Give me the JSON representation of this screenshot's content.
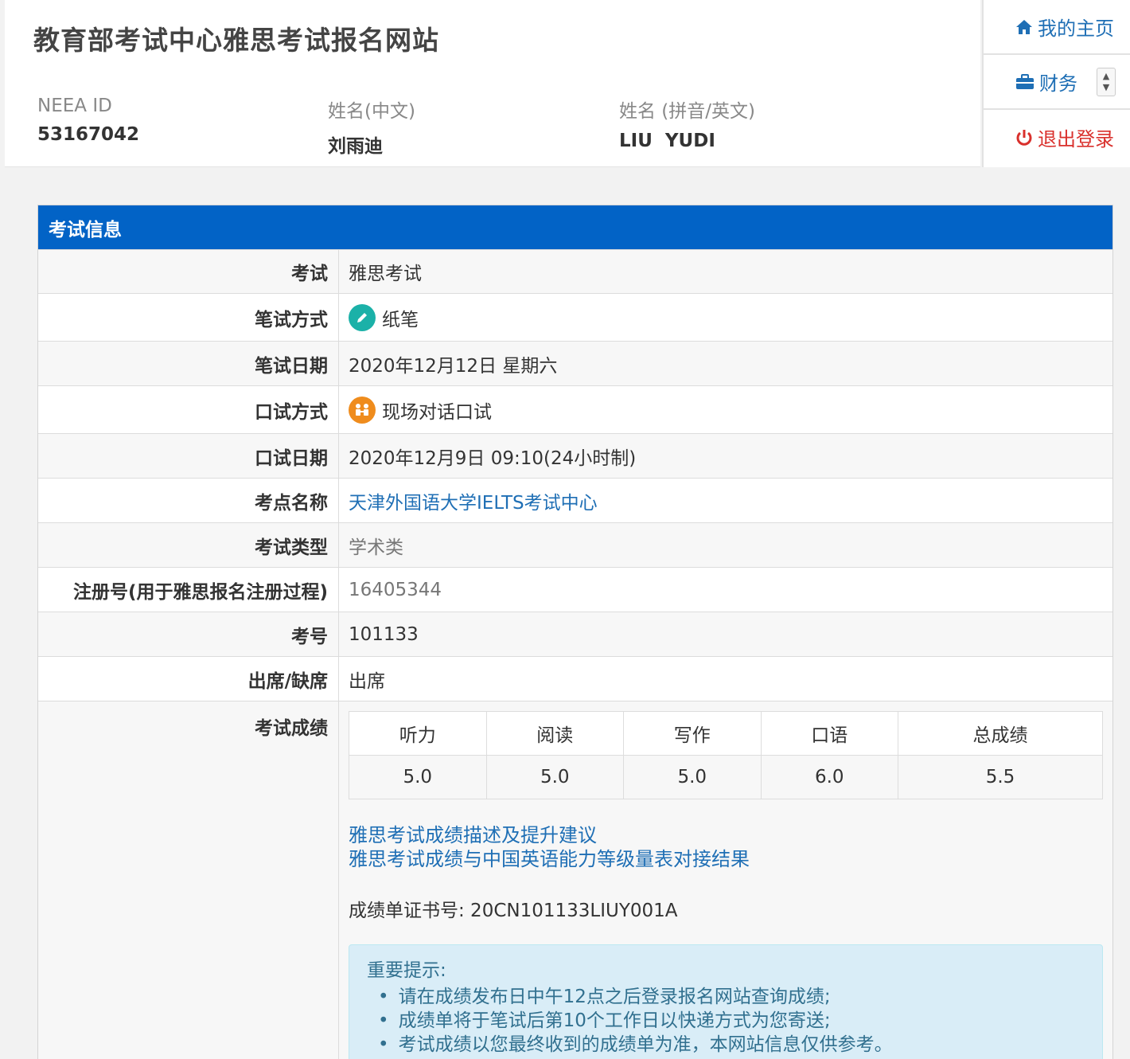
{
  "header": {
    "site_title": "教育部考试中心雅思考试报名网站",
    "neea_id_label": "NEEA ID",
    "neea_id": "53167042",
    "name_cn_label": "姓名(中文)",
    "name_cn": "刘雨迪",
    "name_en_label": "姓名 (拼音/英文)",
    "name_en": "LIU  YUDI"
  },
  "nav": {
    "home": "我的主页",
    "finance": "财务",
    "logout": "退出登录"
  },
  "panel": {
    "heading": "考试信息",
    "rows": [
      {
        "label": "考试",
        "value": "雅思考试"
      },
      {
        "label": "笔试方式",
        "value": "纸笔"
      },
      {
        "label": "笔试日期",
        "value": "2020年12月12日 星期六"
      },
      {
        "label": "口试方式",
        "value": "现场对话口试"
      },
      {
        "label": "口试日期",
        "value": "2020年12月9日 09:10(24小时制)"
      },
      {
        "label": "考点名称",
        "value": "天津外国语大学IELTS考试中心"
      },
      {
        "label": "考试类型",
        "value": "学术类"
      },
      {
        "label": "注册号(用于雅思报名注册过程)",
        "value": "16405344"
      },
      {
        "label": "考号",
        "value": "101133"
      },
      {
        "label": "出席/缺席",
        "value": "出席"
      }
    ],
    "scores_label": "考试成绩",
    "score_headers": [
      "听力",
      "阅读",
      "写作",
      "口语",
      "总成绩"
    ],
    "score_values": [
      "5.0",
      "5.0",
      "5.0",
      "6.0",
      "5.5"
    ],
    "link_description": "雅思考试成绩描述及提升建议",
    "link_cse": "雅思考试成绩与中国英语能力等级量表对接结果",
    "certificate": "成绩单证书号: 20CN101133LIUY001A",
    "notice_title": "重要提示:",
    "notice_items": [
      "请在成绩发布日中午12点之后登录报名网站查询成绩;",
      "成绩单将于笔试后第10个工作日以快递方式为您寄送;",
      "考试成绩以您最终收到的成绩单为准，本网站信息仅供参考。"
    ]
  }
}
